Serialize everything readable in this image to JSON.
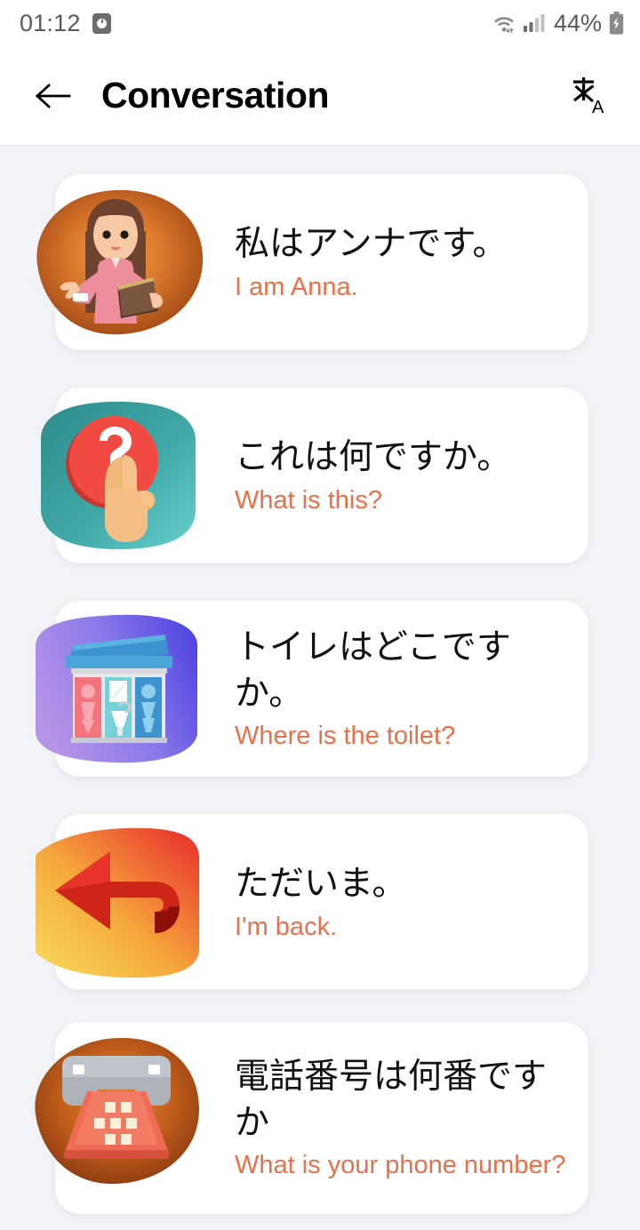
{
  "status_bar": {
    "time": "01:12",
    "alarm_icon": "alarm-clock-icon",
    "wifi_icon": "wifi-icon",
    "signal_icon": "cellular-signal-icon",
    "battery_percent": "44%",
    "battery_icon": "battery-charging-icon"
  },
  "app_bar": {
    "back_icon": "back-arrow-icon",
    "title": "Conversation",
    "translate_icon": "translate-icon"
  },
  "colors": {
    "background": "#F2F3F7",
    "card": "#FFFFFF",
    "primary_text": "#111111",
    "translation_text": "#E8704A",
    "status_text": "#5A5A5C"
  },
  "phrases": [
    {
      "id": "i-am-anna",
      "japanese": "私はアンナです。",
      "english": "I am Anna.",
      "illustration": "woman-reading-book-illustration"
    },
    {
      "id": "what-is-this",
      "japanese": "これは何ですか。",
      "english": "What is this?",
      "illustration": "question-mark-button-illustration"
    },
    {
      "id": "where-is-the-toilet",
      "japanese": "トイレはどこですか。",
      "english": "Where is the toilet?",
      "illustration": "public-restroom-illustration"
    },
    {
      "id": "im-back",
      "japanese": "ただいま。",
      "english": "I'm back.",
      "illustration": "return-arrow-illustration"
    },
    {
      "id": "what-is-your-phone-number",
      "japanese": "電話番号は何番ですか",
      "english": "What is your phone number?",
      "illustration": "telephone-illustration"
    }
  ]
}
